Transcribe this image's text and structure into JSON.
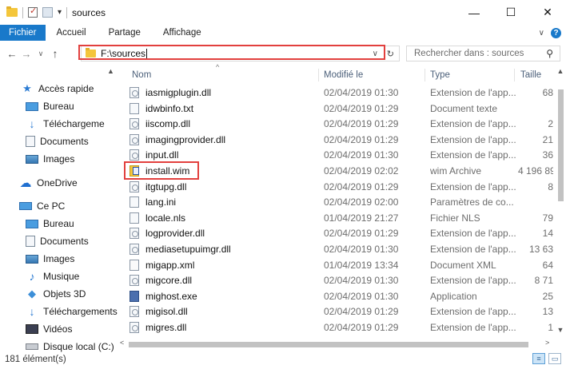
{
  "window": {
    "title": "sources",
    "minimize": "—",
    "maximize": "☐",
    "close": "✕"
  },
  "ribbon": {
    "tabs": [
      "Fichier",
      "Accueil",
      "Partage",
      "Affichage"
    ]
  },
  "address": {
    "path": "F:\\sources",
    "search_placeholder": "Rechercher dans : sources"
  },
  "nav": {
    "items": [
      {
        "label": "Accès rapide",
        "icon": "star-icon",
        "pinned": false
      },
      {
        "label": "Bureau",
        "icon": "desktop-icon",
        "pinned": true
      },
      {
        "label": "Téléchargeme",
        "icon": "download-icon",
        "pinned": true
      },
      {
        "label": "Documents",
        "icon": "documents-icon",
        "pinned": true
      },
      {
        "label": "Images",
        "icon": "pictures-icon",
        "pinned": true
      },
      {
        "label": "OneDrive",
        "icon": "cloud-icon",
        "pinned": false
      },
      {
        "label": "Ce PC",
        "icon": "computer-icon",
        "pinned": false
      },
      {
        "label": "Bureau",
        "icon": "desktop-icon",
        "pinned": false
      },
      {
        "label": "Documents",
        "icon": "documents-icon",
        "pinned": false
      },
      {
        "label": "Images",
        "icon": "pictures-icon",
        "pinned": false
      },
      {
        "label": "Musique",
        "icon": "music-icon",
        "pinned": false
      },
      {
        "label": "Objets 3D",
        "icon": "objects3d-icon",
        "pinned": false
      },
      {
        "label": "Téléchargements",
        "icon": "download-icon",
        "pinned": false
      },
      {
        "label": "Vidéos",
        "icon": "video-icon",
        "pinned": false
      },
      {
        "label": "Disque local (C:)",
        "icon": "disk-icon",
        "pinned": false
      }
    ]
  },
  "columns": {
    "name": "Nom",
    "modified": "Modifié le",
    "type": "Type",
    "size": "Taille"
  },
  "files": [
    {
      "name": "iasmigplugin.dll",
      "modified": "02/04/2019 01:30",
      "type": "Extension de l'app...",
      "size": "68",
      "kind": "dll"
    },
    {
      "name": "idwbinfo.txt",
      "modified": "02/04/2019 01:29",
      "type": "Document texte",
      "size": "",
      "kind": "txt"
    },
    {
      "name": "iiscomp.dll",
      "modified": "02/04/2019 01:29",
      "type": "Extension de l'app...",
      "size": "2",
      "kind": "dll"
    },
    {
      "name": "imagingprovider.dll",
      "modified": "02/04/2019 01:29",
      "type": "Extension de l'app...",
      "size": "21",
      "kind": "dll"
    },
    {
      "name": "input.dll",
      "modified": "02/04/2019 01:30",
      "type": "Extension de l'app...",
      "size": "36",
      "kind": "dll"
    },
    {
      "name": "install.wim",
      "modified": "02/04/2019 02:02",
      "type": "wim Archive",
      "size": "4 196 89",
      "kind": "wim"
    },
    {
      "name": "itgtupg.dll",
      "modified": "02/04/2019 01:29",
      "type": "Extension de l'app...",
      "size": "8",
      "kind": "dll"
    },
    {
      "name": "lang.ini",
      "modified": "02/04/2019 02:00",
      "type": "Paramètres de co...",
      "size": "",
      "kind": "ini"
    },
    {
      "name": "locale.nls",
      "modified": "01/04/2019 21:27",
      "type": "Fichier NLS",
      "size": "79",
      "kind": "txt"
    },
    {
      "name": "logprovider.dll",
      "modified": "02/04/2019 01:29",
      "type": "Extension de l'app...",
      "size": "14",
      "kind": "dll"
    },
    {
      "name": "mediasetupuimgr.dll",
      "modified": "02/04/2019 01:30",
      "type": "Extension de l'app...",
      "size": "13 63",
      "kind": "dll"
    },
    {
      "name": "migapp.xml",
      "modified": "01/04/2019 13:34",
      "type": "Document XML",
      "size": "64",
      "kind": "xml"
    },
    {
      "name": "migcore.dll",
      "modified": "02/04/2019 01:30",
      "type": "Extension de l'app...",
      "size": "8 71",
      "kind": "dll"
    },
    {
      "name": "mighost.exe",
      "modified": "02/04/2019 01:30",
      "type": "Application",
      "size": "25",
      "kind": "exe"
    },
    {
      "name": "migisol.dll",
      "modified": "02/04/2019 01:29",
      "type": "Extension de l'app...",
      "size": "13",
      "kind": "dll"
    },
    {
      "name": "migres.dll",
      "modified": "02/04/2019 01:29",
      "type": "Extension de l'app...",
      "size": "1",
      "kind": "dll"
    }
  ],
  "status": {
    "count": "181 élément(s)"
  }
}
